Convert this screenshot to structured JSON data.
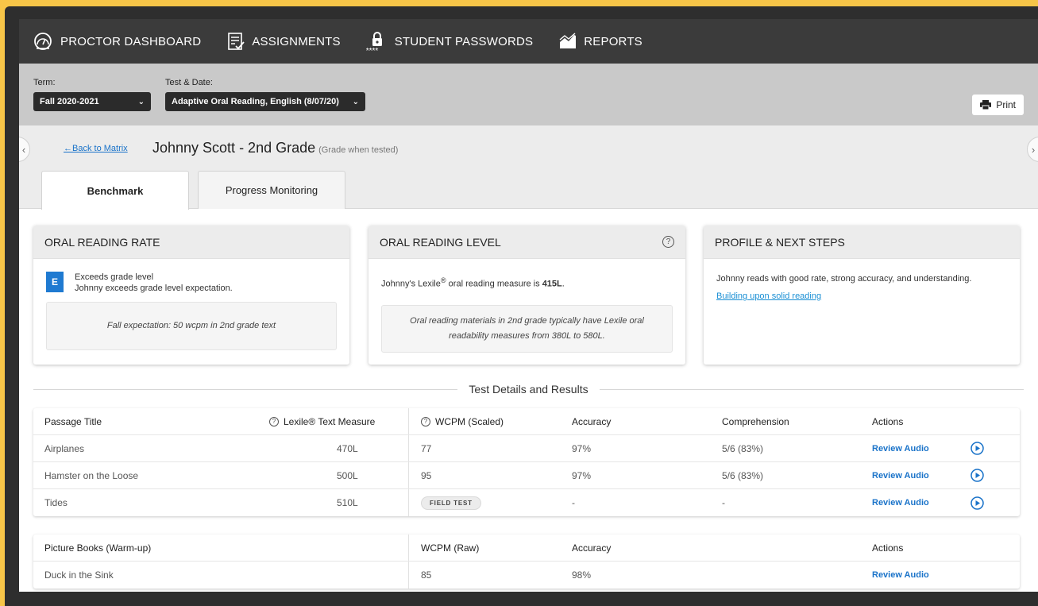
{
  "nav": {
    "dashboard": "PROCTOR DASHBOARD",
    "assignments": "ASSIGNMENTS",
    "passwords": "STUDENT PASSWORDS",
    "passwords_stars": "****",
    "reports": "REPORTS"
  },
  "filters": {
    "term_label": "Term:",
    "term_value": "Fall 2020-2021",
    "test_label": "Test & Date:",
    "test_value": "Adaptive Oral Reading, English (8/07/20)",
    "print_label": "Print"
  },
  "student": {
    "back_link": "←Back to Matrix",
    "name": "Johnny Scott - 2nd Grade",
    "grade_note": "(Grade when tested)"
  },
  "tabs": [
    "Benchmark",
    "Progress Monitoring"
  ],
  "cards": {
    "rate": {
      "title": "ORAL READING RATE",
      "badge": "E",
      "line1": "Exceeds grade level",
      "line2": "Johnny exceeds grade level expectation.",
      "note": "Fall expectation: 50 wcpm in 2nd grade text"
    },
    "level": {
      "title": "ORAL READING LEVEL",
      "help": "?",
      "text_pre": "Johnny's Lexile",
      "reg": "®",
      "text_mid": " oral reading measure is ",
      "measure": "415L",
      "text_end": ".",
      "note": "Oral reading materials in 2nd grade typically have Lexile oral readability measures from 380L to 580L."
    },
    "profile": {
      "title": "PROFILE & NEXT STEPS",
      "text": "Johnny reads with good rate, strong accuracy, and understanding.",
      "link": "Building upon solid reading"
    }
  },
  "section_title": "Test Details and Results",
  "results": {
    "headers": {
      "passage": "Passage Title",
      "lexile": "Lexile® Text Measure",
      "wcpm": "WCPM (Scaled)",
      "accuracy": "Accuracy",
      "comprehension": "Comprehension",
      "actions": "Actions"
    },
    "rows": [
      {
        "passage": "Airplanes",
        "lexile": "470L",
        "wcpm": "77",
        "accuracy": "97%",
        "comprehension": "5/6 (83%)",
        "action": "Review Audio"
      },
      {
        "passage": "Hamster on the Loose",
        "lexile": "500L",
        "wcpm": "95",
        "accuracy": "97%",
        "comprehension": "5/6 (83%)",
        "action": "Review Audio"
      },
      {
        "passage": "Tides",
        "lexile": "510L",
        "wcpm": "FIELD TEST",
        "accuracy": "-",
        "comprehension": "-",
        "action": "Review Audio"
      }
    ]
  },
  "warmup": {
    "headers": {
      "title": "Picture Books (Warm-up)",
      "wcpm": "WCPM (Raw)",
      "accuracy": "Accuracy",
      "actions": "Actions"
    },
    "rows": [
      {
        "title": "Duck in the Sink",
        "wcpm": "85",
        "accuracy": "98%",
        "action": "Review Audio"
      }
    ]
  },
  "colors": {
    "nav_bg": "#3b3b3b",
    "filter_bg": "#c9c9c9",
    "accent_blue": "#1a73c9",
    "badge_blue": "#1f7ad1",
    "frame_yellow": "#f7c548"
  }
}
